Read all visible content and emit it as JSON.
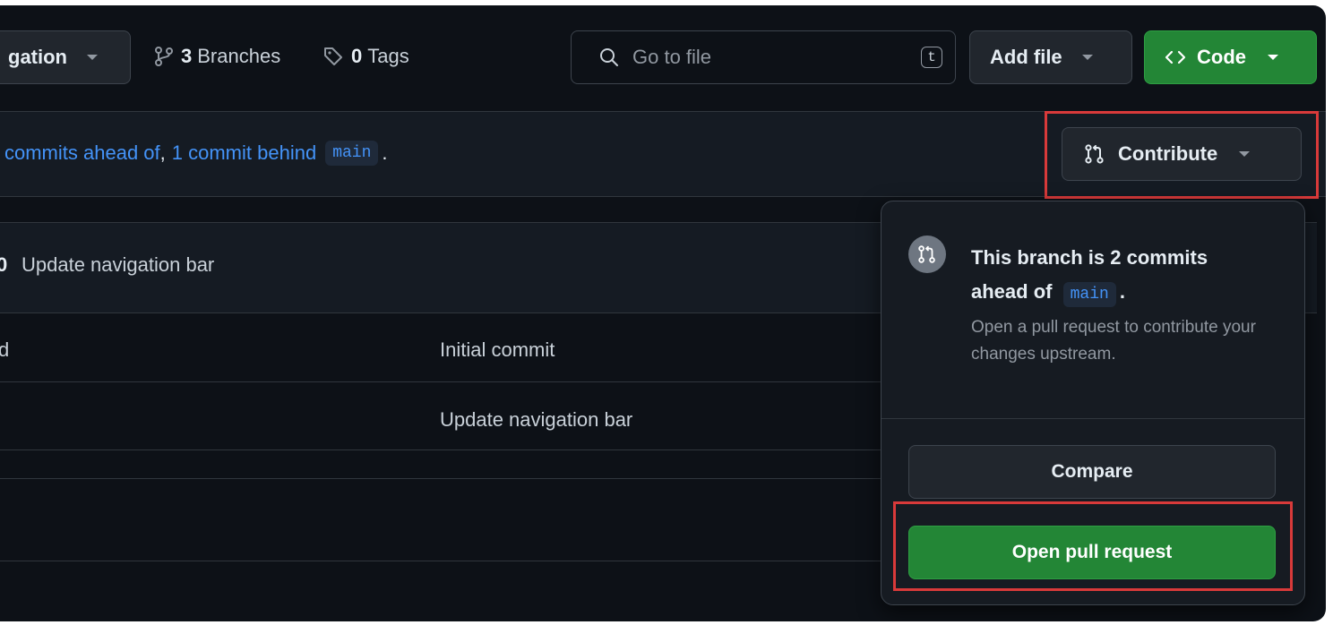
{
  "toolbar": {
    "branch_selector_label": "gation",
    "branches_count": "3",
    "branches_label": "Branches",
    "tags_count": "0",
    "tags_label": "Tags",
    "search_placeholder": "Go to file",
    "search_shortcut": "t",
    "add_file_label": "Add file",
    "code_label": "Code"
  },
  "status_bar": {
    "text_ahead": "commits ahead of",
    "separator": ",",
    "text_behind": "1 commit behind",
    "branch": "main",
    "trailing": ".",
    "contribute_label": "Contribute"
  },
  "latest_commit": {
    "prefix": "0",
    "message": "Update navigation bar"
  },
  "file_rows": [
    {
      "name": "d",
      "commit": "Initial commit"
    },
    {
      "name": "",
      "commit": "Update navigation bar"
    }
  ],
  "contribute_popover": {
    "title_prefix": "This branch is 2 commits",
    "title_ahead": "ahead of",
    "branch": "main",
    "title_suffix": ".",
    "description": "Open a pull request to contribute your changes upstream.",
    "compare_label": "Compare",
    "open_pr_label": "Open pull request"
  },
  "colors": {
    "background": "#0d1117",
    "accent_green": "#238636",
    "link_blue": "#4493f8",
    "highlight_red": "#d93a3a"
  }
}
